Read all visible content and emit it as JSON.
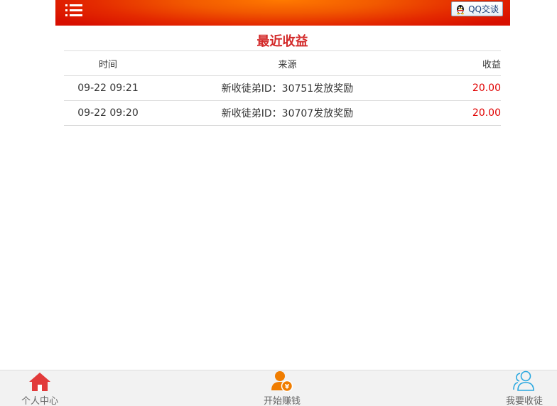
{
  "header": {
    "qq_label": "QQ交谈"
  },
  "title": "最近收益",
  "table": {
    "columns": [
      "时间",
      "来源",
      "收益"
    ],
    "rows": [
      {
        "time": "09-22 09:21",
        "source": "新收徒弟ID：30751发放奖励",
        "amount": "20.00"
      },
      {
        "time": "09-22 09:20",
        "source": "新收徒弟ID：30707发放奖励",
        "amount": "20.00"
      }
    ]
  },
  "bottom_nav": {
    "items": [
      {
        "label": "个人中心",
        "icon": "home-icon",
        "color": "#e23a3a"
      },
      {
        "label": "开始赚钱",
        "icon": "user-money-icon",
        "color": "#f07d00"
      },
      {
        "label": "我要收徒",
        "icon": "users-icon",
        "color": "#2aa8e0"
      }
    ]
  },
  "colors": {
    "accent": "#d32a2a",
    "amount": "#e00000",
    "header_center": "#ff7a00",
    "header_edge": "#d80f00"
  }
}
